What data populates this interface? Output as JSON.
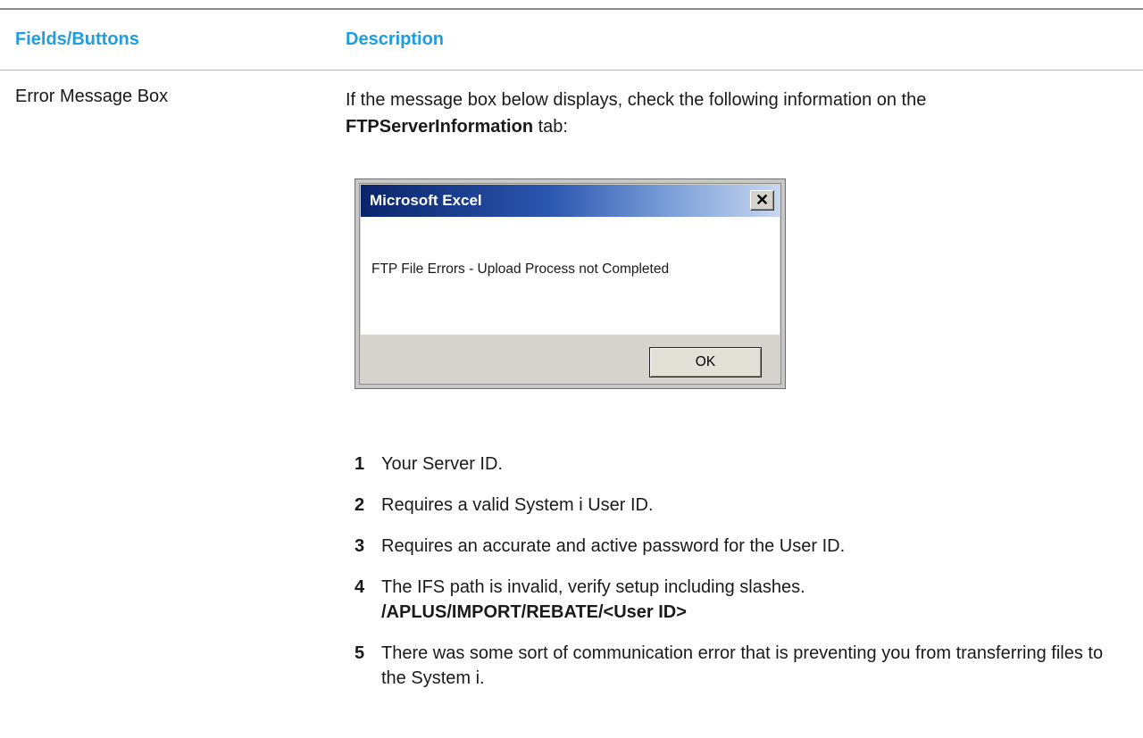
{
  "table": {
    "headers": {
      "field": "Fields/Buttons",
      "description": "Description"
    },
    "row": {
      "field": "Error Message Box",
      "intro_before": "If the message box below displays, check the following information on the ",
      "intro_bold": "FTPServerInformation",
      "intro_after": " tab:"
    }
  },
  "dialog": {
    "title": "Microsoft Excel",
    "close_glyph": "✕",
    "message": "FTP File Errors - Upload Process not Completed",
    "ok_label": "OK"
  },
  "steps": [
    {
      "number": "1",
      "text": "Your Server ID."
    },
    {
      "number": "2",
      "text": "Requires a valid System i User ID."
    },
    {
      "number": "3",
      "text": "Requires an accurate and active password for the User ID."
    },
    {
      "number": "4",
      "text": "The IFS path is invalid, verify setup including slashes.",
      "path": "/APLUS/IMPORT/REBATE/<User ID>"
    },
    {
      "number": "5",
      "text": "There was some sort of communication error that is preventing you from transferring files to the System i."
    }
  ],
  "colors": {
    "header_accent": "#1e9ee0",
    "titlebar_dark": "#0a246a"
  }
}
